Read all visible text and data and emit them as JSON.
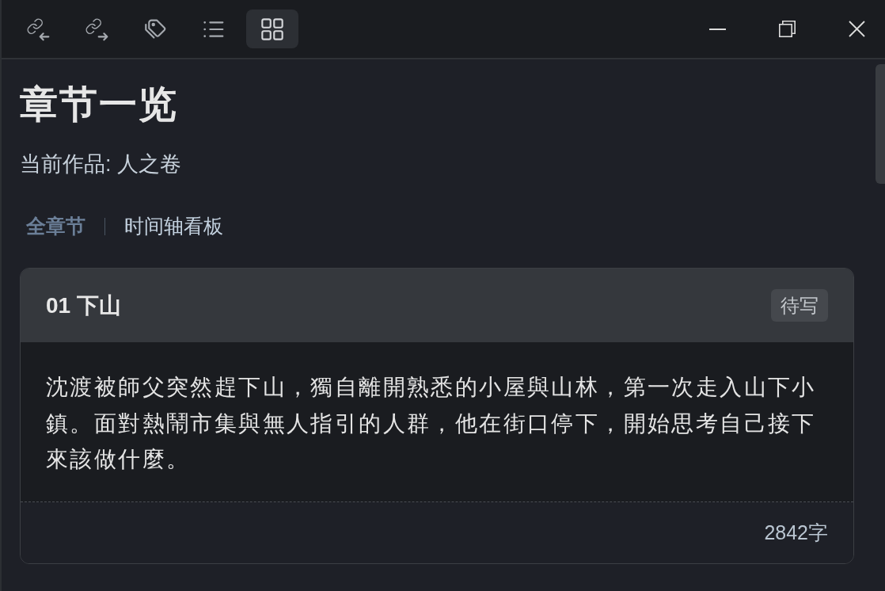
{
  "toolbar": {
    "buttons": [
      {
        "kind": "backlinks",
        "selected": false
      },
      {
        "kind": "outlinks",
        "selected": false
      },
      {
        "kind": "tags",
        "selected": false
      },
      {
        "kind": "outline",
        "selected": false
      },
      {
        "kind": "grid",
        "selected": true
      }
    ]
  },
  "page": {
    "title": "章节一览",
    "subtitle": "当前作品: 人之卷"
  },
  "view_tabs": [
    {
      "label": "全章节",
      "selected": true
    },
    {
      "label": "时间轴看板",
      "selected": false
    }
  ],
  "chapters": [
    {
      "title": "01 下山",
      "status": "待写",
      "summary": "沈渡被師父突然趕下山，獨自離開熟悉的小屋與山林，第一次走入山下小鎮。面對熱鬧市集與無人指引的人群，他在街口停下，開始思考自己接下來該做什麼。",
      "word_count": "2842字"
    }
  ]
}
